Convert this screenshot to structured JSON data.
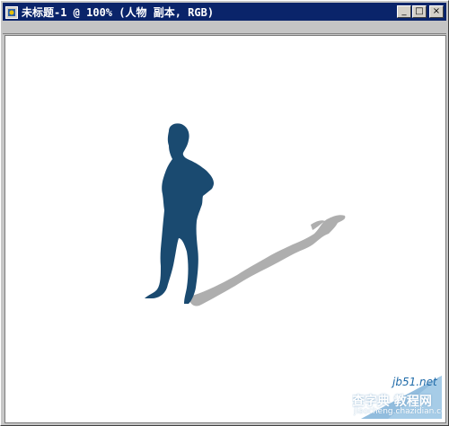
{
  "window": {
    "title": "未标题-1 @ 100% (人物 副本, RGB)",
    "controls": {
      "minimize": "_",
      "maximize": "□",
      "close": "×"
    }
  },
  "watermark": {
    "site": "jb51.net",
    "brand": "查字典 教程网",
    "domain": "jiaocheng.chazidian.com"
  },
  "colors": {
    "figure": "#1a4a70",
    "shadow": "#9a9a9a",
    "canvas": "#ffffff",
    "titlebar": "#0a246a"
  }
}
